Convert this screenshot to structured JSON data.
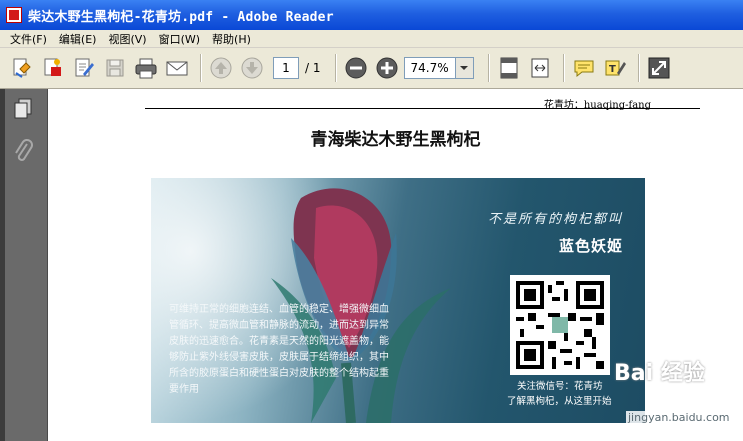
{
  "window": {
    "title": "柴达木野生黑枸杞-花青坊.pdf - Adobe Reader"
  },
  "menu": [
    {
      "label": "文件(F)"
    },
    {
      "label": "编辑(E)"
    },
    {
      "label": "视图(V)"
    },
    {
      "label": "窗口(W)"
    },
    {
      "label": "帮助(H)"
    }
  ],
  "toolbar": {
    "page_current": "1",
    "page_total": "/ 1",
    "zoom": "74.7%"
  },
  "document": {
    "header": "花青坊：huaqing-fang",
    "title": "青海柴达木野生黑枸杞",
    "image": {
      "script_text": "不是所有的枸杞都叫",
      "brand": "蓝色妖姬",
      "body": "可维持正常的细胞连结、血管的稳定、增强微细血管循环、提高微血管和静脉的流动，进而达到异常皮肤的迅速愈合。花青素是天然的阳光遮盖物，能够防止紫外线侵害皮肤，皮肤属于结缔组织，其中所含的胶原蛋白和硬性蛋白对皮肤的整个结构起重要作用",
      "caption_1": "关注微信号：花青坊",
      "caption_2": "了解黑枸杞，从这里开始"
    }
  },
  "watermark": {
    "logo": "Bai 经验",
    "url": "jingyan.baidu.com"
  }
}
